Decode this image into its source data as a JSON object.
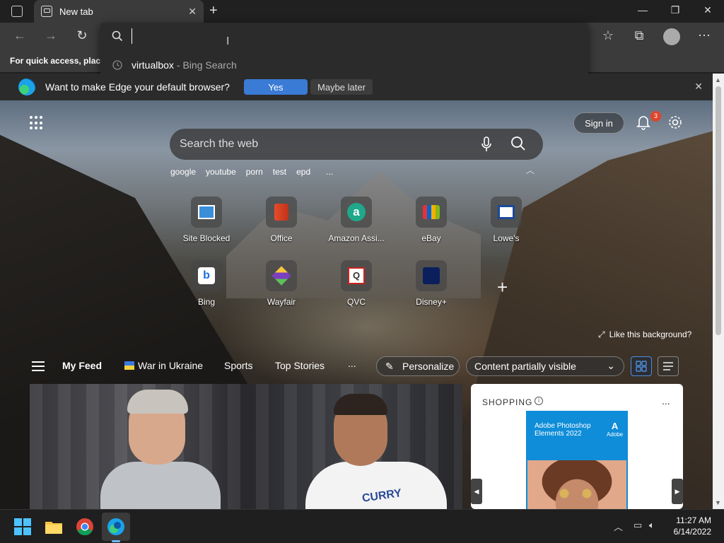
{
  "browser": {
    "tab_title": "New tab",
    "address_value": "",
    "suggestion": {
      "text": "virtualbox",
      "source": "- Bing Search"
    },
    "favorites_hint": "For quick access, place y"
  },
  "default_prompt": {
    "message": "Want to make Edge your default browser?",
    "yes_label": "Yes",
    "later_label": "Maybe later"
  },
  "page": {
    "signin_label": "Sign in",
    "notification_count": "3",
    "search_placeholder": "Search the web",
    "quick_links": [
      "google",
      "youtube",
      "porn",
      "test",
      "epd"
    ],
    "quick_links_more": "...",
    "tiles": [
      {
        "label": "Site Blocked",
        "icon": "site-blocked-icon"
      },
      {
        "label": "Office",
        "icon": "office-icon"
      },
      {
        "label": "Amazon Assi...",
        "icon": "amazon-icon"
      },
      {
        "label": "eBay",
        "icon": "ebay-icon"
      },
      {
        "label": "Lowe's",
        "icon": "lowes-icon"
      },
      {
        "label": "Bing",
        "icon": "bing-icon"
      },
      {
        "label": "Wayfair",
        "icon": "wayfair-icon"
      },
      {
        "label": "QVC",
        "icon": "qvc-icon"
      },
      {
        "label": "Disney+",
        "icon": "disney-icon"
      }
    ],
    "like_background": "Like this background?"
  },
  "feed": {
    "tabs": [
      "My Feed",
      "War in Ukraine",
      "Sports",
      "Top Stories"
    ],
    "more": "...",
    "personalize_label": "Personalize",
    "content_visibility": "Content partially visible"
  },
  "shopping": {
    "title": "SHOPPING",
    "product_name": "Adobe Photoshop Elements 2022",
    "brand": "Adobe",
    "more": "..."
  },
  "hero": {
    "jersey_text": "CURRY"
  },
  "taskbar": {
    "time": "11:27 AM",
    "date": "6/14/2022"
  },
  "colors": {
    "accent": "#3a7bd5",
    "taskbar_bg": "#1f1f1f",
    "tab_bg": "#3b3b3b",
    "badge": "#e0442b"
  }
}
